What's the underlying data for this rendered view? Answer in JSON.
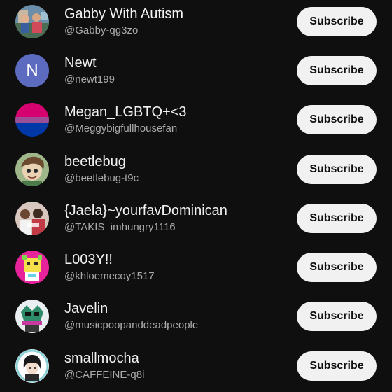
{
  "subscribe_label": "Subscribe",
  "channels": [
    {
      "name": "Gabby With Autism",
      "handle": "@Gabby-qg3zo",
      "avatar": "photo-avatar"
    },
    {
      "name": "Newt",
      "handle": "@newt199",
      "avatar": "letter-avatar",
      "avatar_letter": "N",
      "avatar_color": "#5c6bc0"
    },
    {
      "name": "Megan_LGBTQ+<3",
      "handle": "@Meggybigfullhousefan",
      "avatar": "bi-flag-avatar"
    },
    {
      "name": "beetlebug",
      "handle": "@beetlebug-t9c",
      "avatar": "drawing-avatar"
    },
    {
      "name": "{Jaela}~yourfavDominican",
      "handle": "@TAKIS_imhungry1116",
      "avatar": "photo-avatar"
    },
    {
      "name": "L003Y!!",
      "handle": "@khloemecoy1517",
      "avatar": "cartoon-avatar"
    },
    {
      "name": "Javelin",
      "handle": "@musicpoopanddeadpeople",
      "avatar": "cartoon-avatar"
    },
    {
      "name": "smallmocha",
      "handle": "@CAFFEINE-q8i",
      "avatar": "anime-avatar"
    }
  ]
}
